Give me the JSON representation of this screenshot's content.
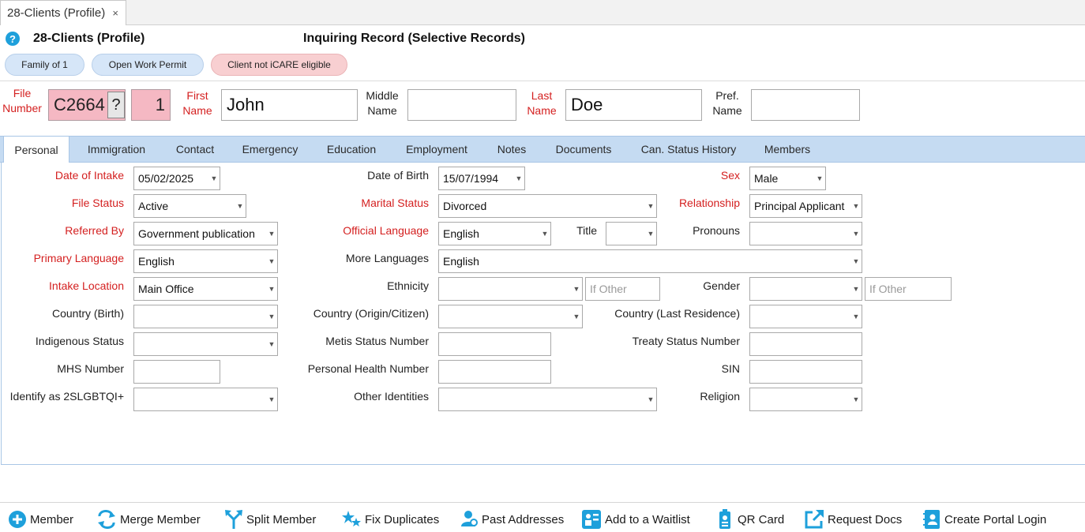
{
  "doc_tab": {
    "label": "28-Clients (Profile)",
    "close": "×"
  },
  "header": {
    "help": "?",
    "title": "28-Clients (Profile)",
    "record_mode": "Inquiring Record (Selective Records)"
  },
  "pills": [
    {
      "label": "Family of 1"
    },
    {
      "label": "Open Work Permit"
    },
    {
      "label": "Client not iCARE eligible"
    }
  ],
  "identity": {
    "file_number_label_1": "File",
    "file_number_label_2": "Number",
    "file_number": "C2664",
    "lookup": "?",
    "member_no": "1",
    "first_label_1": "First",
    "first_label_2": "Name",
    "first_name": "John",
    "middle_label_1": "Middle",
    "middle_label_2": "Name",
    "middle_name": "",
    "last_label_1": "Last",
    "last_label_2": "Name",
    "last_name": "Doe",
    "pref_label_1": "Pref.",
    "pref_label_2": "Name",
    "pref_name": ""
  },
  "tabs": [
    {
      "label": "Personal"
    },
    {
      "label": "Immigration"
    },
    {
      "label": "Contact"
    },
    {
      "label": "Emergency"
    },
    {
      "label": "Education"
    },
    {
      "label": "Employment"
    },
    {
      "label": "Notes"
    },
    {
      "label": "Documents"
    },
    {
      "label": "Can. Status History"
    },
    {
      "label": "Members"
    }
  ],
  "fields": {
    "date_of_intake": {
      "label": "Date of Intake",
      "value": "05/02/2025"
    },
    "file_status": {
      "label": "File Status",
      "value": "Active"
    },
    "referred_by": {
      "label": "Referred By",
      "value": "Government publication"
    },
    "primary_language": {
      "label": "Primary Language",
      "value": "English"
    },
    "intake_location": {
      "label": "Intake Location",
      "value": "Main Office"
    },
    "country_birth": {
      "label": "Country (Birth)",
      "value": ""
    },
    "indigenous_status": {
      "label": "Indigenous Status",
      "value": ""
    },
    "mhs_number": {
      "label": "MHS Number",
      "value": ""
    },
    "identify_2slgbtqi": {
      "label": "Identify as 2SLGBTQI+",
      "value": ""
    },
    "date_of_birth": {
      "label": "Date of Birth",
      "value": "15/07/1994"
    },
    "marital_status": {
      "label": "Marital Status",
      "value": "Divorced"
    },
    "official_language": {
      "label": "Official Language",
      "value": "English"
    },
    "title": {
      "label": "Title",
      "value": ""
    },
    "more_languages": {
      "label": "More Languages",
      "value": "English"
    },
    "ethnicity": {
      "label": "Ethnicity",
      "value": "",
      "other_placeholder": "If Other"
    },
    "country_origin": {
      "label": "Country (Origin/Citizen)",
      "value": ""
    },
    "metis_status_number": {
      "label": "Metis Status Number",
      "value": ""
    },
    "personal_health_number": {
      "label": "Personal Health Number",
      "value": ""
    },
    "other_identities": {
      "label": "Other Identities",
      "value": ""
    },
    "sex": {
      "label": "Sex",
      "value": "Male"
    },
    "relationship": {
      "label": "Relationship",
      "value": "Principal Applicant"
    },
    "pronouns": {
      "label": "Pronouns",
      "value": ""
    },
    "gender": {
      "label": "Gender",
      "value": "",
      "other_placeholder": "If Other"
    },
    "country_last_residence": {
      "label": "Country (Last Residence)",
      "value": ""
    },
    "treaty_status_number": {
      "label": "Treaty Status Number",
      "value": ""
    },
    "sin": {
      "label": "SIN",
      "value": ""
    },
    "religion": {
      "label": "Religion",
      "value": ""
    }
  },
  "toolbar": [
    {
      "label": "Member",
      "icon": "add-circle-icon"
    },
    {
      "label": "Merge Member",
      "icon": "merge-arrows-icon"
    },
    {
      "label": "Split Member",
      "icon": "split-arrows-icon"
    },
    {
      "label": "Fix Duplicates",
      "icon": "stars-icon"
    },
    {
      "label": "Past Addresses",
      "icon": "person-location-icon"
    },
    {
      "label": "Add to a Waitlist",
      "icon": "waitlist-icon"
    },
    {
      "label": "QR Card",
      "icon": "id-badge-icon"
    },
    {
      "label": "Request Docs",
      "icon": "external-link-icon"
    },
    {
      "label": "Create Portal Login",
      "icon": "contact-book-icon"
    }
  ],
  "colors": {
    "required_label": "#d42020",
    "tab_bar": "#c5dbf2",
    "accent_icon": "#1ea0db",
    "pink_field": "#f5b8c3"
  }
}
